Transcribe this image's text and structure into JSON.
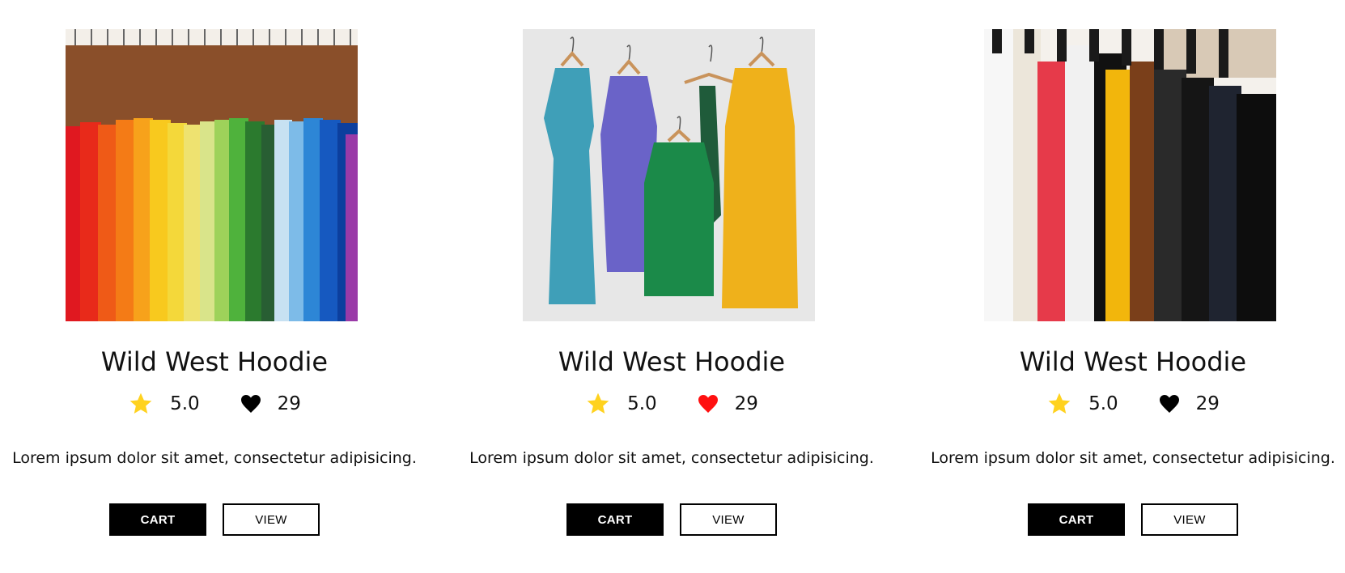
{
  "colors": {
    "star": "#FFD21F",
    "heart_default": "#000000",
    "heart_liked": "#FF1010",
    "button_dark": "#000000"
  },
  "products": [
    {
      "title": "Wild West Hoodie",
      "rating": "5.0",
      "likes": "29",
      "liked": false,
      "description": "Lorem ipsum dolor sit amet, consectetur adipisicing.",
      "cart_label": "CART",
      "view_label": "VIEW"
    },
    {
      "title": "Wild West Hoodie",
      "rating": "5.0",
      "likes": "29",
      "liked": true,
      "description": "Lorem ipsum dolor sit amet, consectetur adipisicing.",
      "cart_label": "CART",
      "view_label": "VIEW"
    },
    {
      "title": "Wild West Hoodie",
      "rating": "5.0",
      "likes": "29",
      "liked": false,
      "description": "Lorem ipsum dolor sit amet, consectetur adipisicing.",
      "cart_label": "CART",
      "view_label": "VIEW"
    }
  ]
}
